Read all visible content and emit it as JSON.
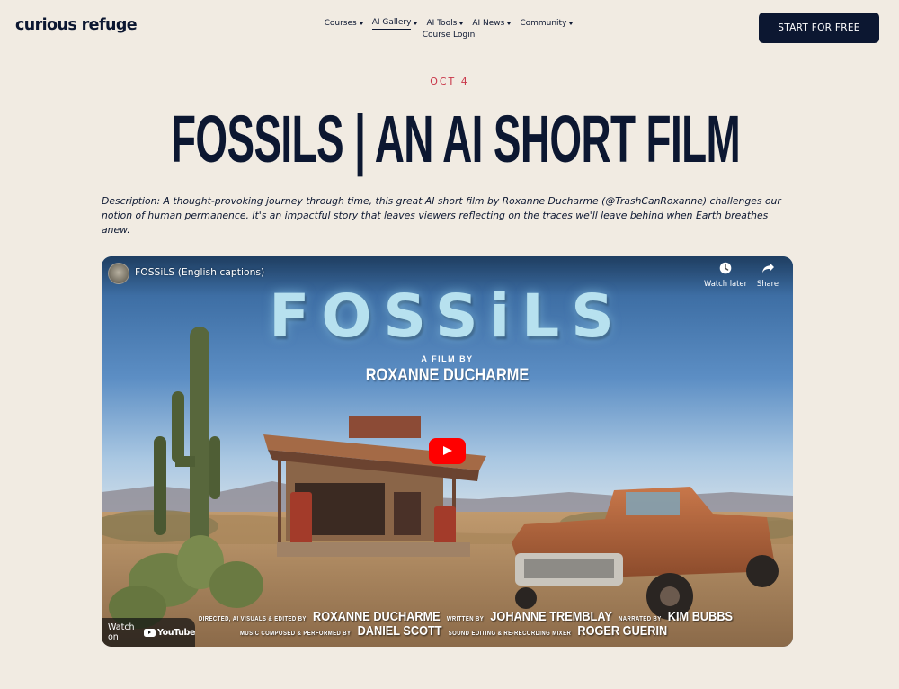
{
  "header": {
    "logo": "curious refuge",
    "nav": [
      {
        "label": "Courses",
        "has_dropdown": true,
        "active": false
      },
      {
        "label": "AI Gallery",
        "has_dropdown": true,
        "active": true
      },
      {
        "label": "AI Tools",
        "has_dropdown": true,
        "active": false
      },
      {
        "label": "AI News",
        "has_dropdown": true,
        "active": false
      },
      {
        "label": "Community",
        "has_dropdown": true,
        "active": false
      }
    ],
    "login": "Course Login",
    "cta": "START FOR FREE"
  },
  "post": {
    "date": "OCT 4",
    "title": "FOSSILS | AN AI SHORT FILM",
    "description": "Description: A thought-provoking journey through time, this great AI short film by Roxanne Ducharme (@TrashCanRoxanne) challenges our notion of human permanence. It's an impactful story that leaves viewers reflecting on the traces we'll leave behind when Earth breathes anew."
  },
  "video": {
    "title": "FOSSiLS (English captions)",
    "watch_later": "Watch later",
    "share": "Share",
    "watch_on": "Watch on",
    "youtube": "YouTube",
    "poster": {
      "title": "FOSSiLS",
      "film_by": "A FILM BY",
      "director": "ROXANNE DUCHARME",
      "credits_line1": [
        {
          "role": "DIRECTED, AI VISUALS & EDITED BY",
          "name": "ROXANNE DUCHARME"
        },
        {
          "role": "WRITTEN BY",
          "name": "JOHANNE TREMBLAY"
        },
        {
          "role": "NARRATED BY",
          "name": "KIM BUBBS"
        }
      ],
      "credits_line2": [
        {
          "role": "MUSIC COMPOSED & PERFORMED BY",
          "name": "DANIEL SCOTT"
        },
        {
          "role": "SOUND EDITING & RE-RECORDING MIXER",
          "name": "ROGER GUERIN"
        }
      ]
    }
  },
  "icons": {
    "watch_later": "clock-icon",
    "share": "share-arrow-icon",
    "play": "play-icon",
    "nav_caret": "chevron-down-icon"
  },
  "colors": {
    "background": "#f1ebe2",
    "navy": "#0c1731",
    "date_red": "#c9374a",
    "play_red": "#ff0000"
  }
}
